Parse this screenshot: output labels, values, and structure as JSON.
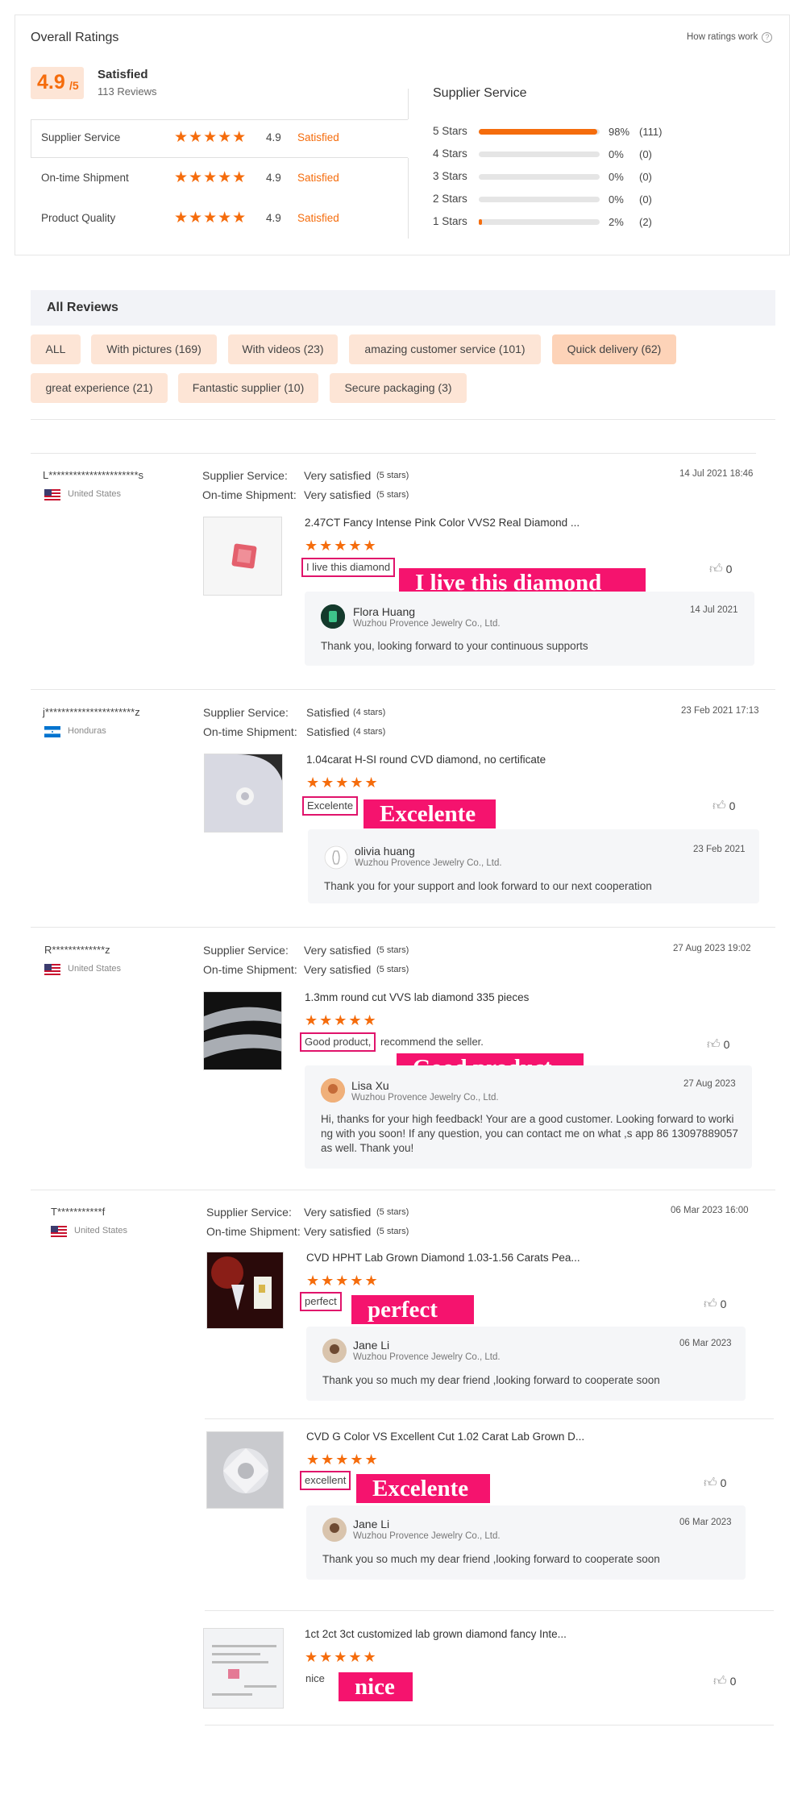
{
  "overall": {
    "title": "Overall Ratings",
    "how_link": "How ratings work",
    "score": "4.9",
    "score_den": "/5",
    "score_label": "Satisfied",
    "reviews": "113 Reviews",
    "rows": [
      {
        "label": "Supplier Service",
        "stars": 5,
        "value": "4.9",
        "status": "Satisfied"
      },
      {
        "label": "On-time Shipment",
        "stars": 5,
        "value": "4.9",
        "status": "Satisfied"
      },
      {
        "label": "Product Quality",
        "stars": 5,
        "value": "4.9",
        "status": "Satisfied"
      }
    ],
    "breakdown_title": "Supplier Service",
    "breakdown": [
      {
        "label": "5 Stars",
        "pct": "98%",
        "count": "(111)",
        "fill": 0.98
      },
      {
        "label": "4 Stars",
        "pct": "0%",
        "count": "(0)",
        "fill": 0
      },
      {
        "label": "3 Stars",
        "pct": "0%",
        "count": "(0)",
        "fill": 0
      },
      {
        "label": "2 Stars",
        "pct": "0%",
        "count": "(0)",
        "fill": 0
      },
      {
        "label": "1 Stars",
        "pct": "2%",
        "count": "(2)",
        "fill": 0.02
      }
    ]
  },
  "all_reviews": {
    "title": "All Reviews",
    "chips": [
      "ALL",
      "With pictures (169)",
      "With videos (23)",
      "amazing customer service (101)",
      "Quick delivery (62)",
      "great experience (21)",
      "Fantastic supplier (10)",
      "Secure packaging (3)"
    ]
  },
  "common": {
    "supplier_service": "Supplier Service:",
    "on_time": "On-time Shipment:",
    "very_satisfied": "Very satisfied",
    "satisfied": "Satisfied",
    "five_stars": "(5 stars)",
    "four_stars": "(4 stars)",
    "company": "Wuzhou Provence Jewelry Co., Ltd.",
    "like_count": "0"
  },
  "reviews": [
    {
      "user": "L**********************s",
      "country": "United States",
      "date": "14 Jul 2021 18:46",
      "product": "2.47CT Fancy Intense Pink Color VVS2 Real Diamond ...",
      "comment": "I live this diamond",
      "banner": "I live this diamond",
      "reply_name": "Flora Huang",
      "reply_date": "14 Jul 2021",
      "reply_text": "Thank you,  looking forward to your continuous supports"
    },
    {
      "user": "j**********************z",
      "country": "Honduras",
      "date": "23 Feb 2021 17:13",
      "product": "1.04carat H-SI round CVD diamond, no certificate",
      "comment": "Excelente",
      "banner": "Excelente",
      "reply_name": "olivia huang",
      "reply_date": "23 Feb 2021",
      "reply_text": "Thank you for your support and look forward to our next cooperation"
    },
    {
      "user": "R*************z",
      "country": "United States",
      "date": "27 Aug 2023 19:02",
      "product": "1.3mm round cut VVS lab diamond 335 pieces",
      "comment": "Good product,",
      "comment_rest": "recommend the seller.",
      "banner": "Good product",
      "reply_name": "Lisa Xu",
      "reply_date": "27 Aug 2023",
      "reply_text": "Hi, thanks for your high feedback! Your are a good customer. Looking forward to working with you soon! If any question, you can contact me on what ,s app 86 13097889057 as well. Thank you!"
    },
    {
      "user": "T***********f",
      "country": "United States",
      "date": "06 Mar 2023 16:00",
      "items": [
        {
          "product": "CVD HPHT Lab Grown Diamond 1.03-1.56 Carats Pea...",
          "comment": "perfect",
          "banner": "perfect",
          "reply_name": "Jane Li",
          "reply_date": "06 Mar 2023",
          "reply_text": "Thank you so much my dear friend ,looking forward to cooperate soon"
        },
        {
          "product": "CVD G Color VS Excellent Cut 1.02 Carat Lab Grown D...",
          "comment": "excellent",
          "banner": "Excelente",
          "reply_name": "Jane Li",
          "reply_date": "06 Mar 2023",
          "reply_text": "Thank you so much my dear friend ,looking forward to cooperate soon"
        },
        {
          "product": "1ct 2ct 3ct customized lab grown diamond fancy Inte...",
          "comment": "nice",
          "banner": "nice"
        }
      ]
    }
  ],
  "colors": {
    "accent": "#f56c0c",
    "highlight": "#f5136e",
    "chip_bg": "#fde5d6"
  }
}
